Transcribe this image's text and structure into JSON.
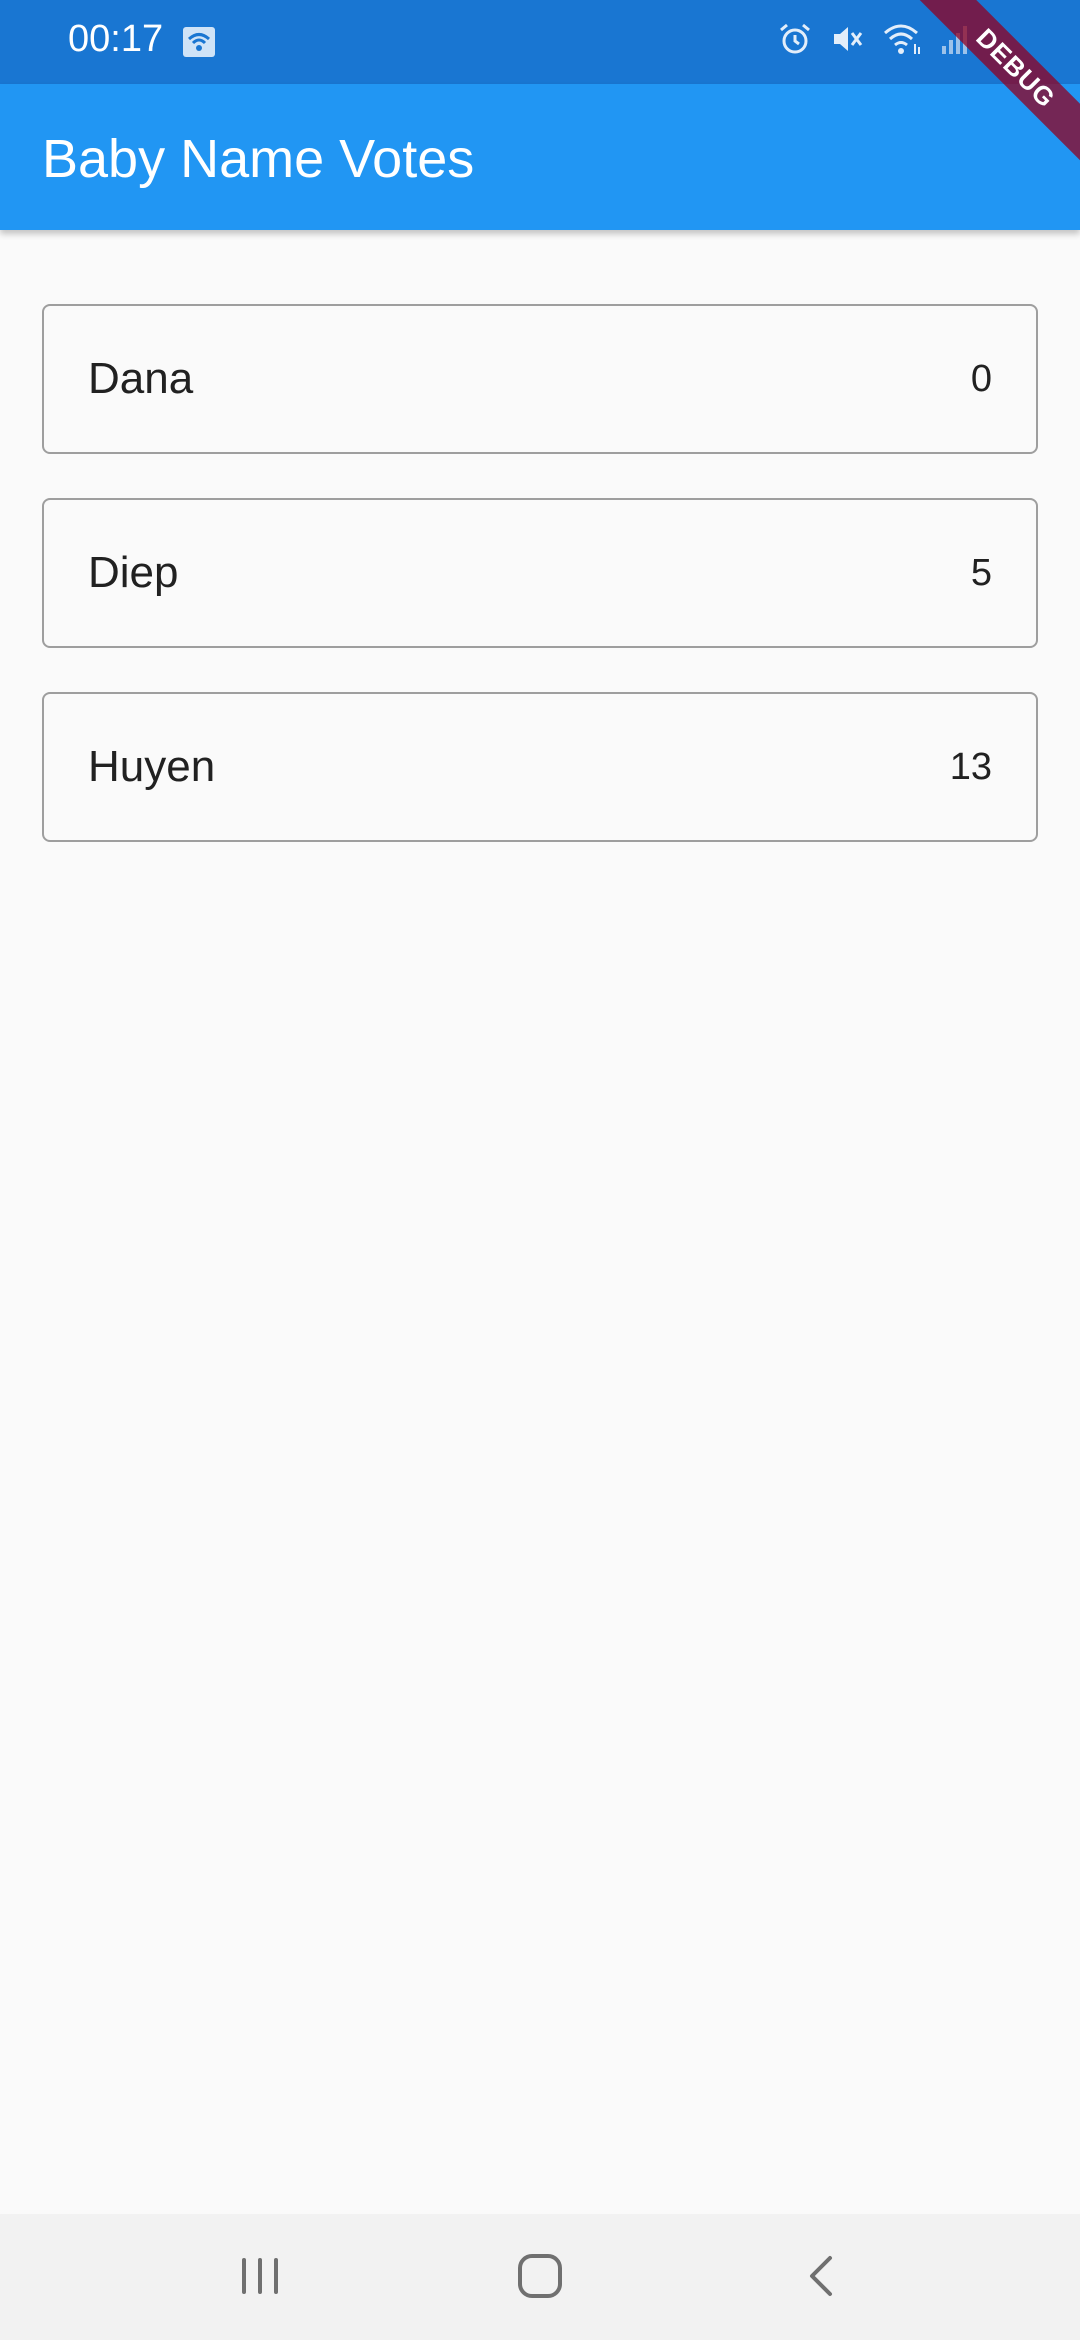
{
  "status_bar": {
    "time": "00:17",
    "icons": [
      "wifi-hotspot-icon",
      "alarm-icon",
      "mute-icon",
      "wifi-icon",
      "signal-icon"
    ]
  },
  "app_bar": {
    "title": "Baby Name Votes"
  },
  "debug_banner": {
    "label": "DEBUG"
  },
  "names": [
    {
      "name": "Dana",
      "votes": "0"
    },
    {
      "name": "Diep",
      "votes": "5"
    },
    {
      "name": "Huyen",
      "votes": "13"
    }
  ],
  "nav_bar": {
    "buttons": [
      "recent-apps-icon",
      "home-icon",
      "back-icon"
    ]
  },
  "colors": {
    "status_bar": "#1976d2",
    "app_bar": "#2196f3",
    "background": "#fafafa",
    "card_border": "#9e9e9e"
  }
}
